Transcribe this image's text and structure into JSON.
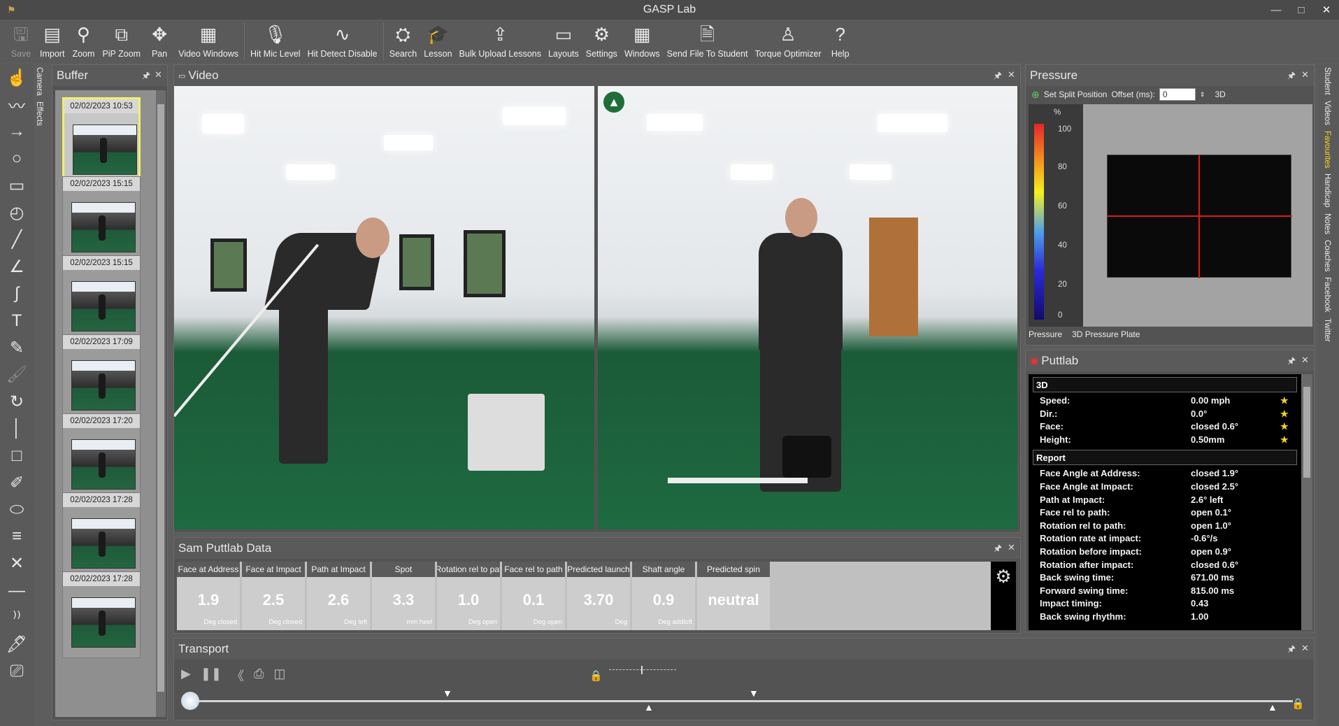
{
  "window": {
    "title": "GASP Lab",
    "minimize": "—",
    "maximize": "□",
    "close": "✕"
  },
  "toolbar": [
    {
      "label": "Save",
      "icon": "save-icon",
      "glyph": "🖫",
      "disabled": true
    },
    {
      "label": "Import",
      "icon": "import-icon",
      "glyph": "▤"
    },
    {
      "label": "Zoom",
      "icon": "zoom-icon",
      "glyph": "⚲"
    },
    {
      "label": "PiP Zoom",
      "icon": "pip-zoom-icon",
      "glyph": "⧉"
    },
    {
      "label": "Pan",
      "icon": "pan-icon",
      "glyph": "✥"
    },
    {
      "label": "Video Windows",
      "icon": "video-windows-icon",
      "glyph": "▦"
    },
    {
      "label": "Hit Mic Level",
      "icon": "microphone-icon",
      "glyph": "🎙"
    },
    {
      "label": "Hit Detect Disable",
      "icon": "hit-detect-icon",
      "glyph": "∿"
    },
    {
      "label": "Search",
      "icon": "search-icon",
      "glyph": "⛭"
    },
    {
      "label": "Lesson",
      "icon": "lesson-icon",
      "glyph": "🎓"
    },
    {
      "label": "Bulk Upload Lessons",
      "icon": "bulk-upload-icon",
      "glyph": "⇪"
    },
    {
      "label": "Layouts",
      "icon": "layouts-icon",
      "glyph": "▭"
    },
    {
      "label": "Settings",
      "icon": "settings-icon",
      "glyph": "⚙"
    },
    {
      "label": "Windows",
      "icon": "windows-icon",
      "glyph": "▦"
    },
    {
      "label": "Send File To Student",
      "icon": "send-file-icon",
      "glyph": "🗎"
    },
    {
      "label": "Torque Optimizer",
      "icon": "torque-optimizer-icon",
      "glyph": "♙"
    },
    {
      "label": "Help",
      "icon": "help-icon",
      "glyph": "?"
    }
  ],
  "left_tools": [
    {
      "name": "hand-tool-icon",
      "glyph": "☝",
      "disabled": true
    },
    {
      "name": "freehand-tool-icon",
      "glyph": "〰"
    },
    {
      "name": "arrow-tool-icon",
      "glyph": "→"
    },
    {
      "name": "circle-tool-icon",
      "glyph": "○"
    },
    {
      "name": "rectangle-tool-icon",
      "glyph": "▭"
    },
    {
      "name": "clock-tool-icon",
      "glyph": "◴"
    },
    {
      "name": "line-tool-icon",
      "glyph": "╱"
    },
    {
      "name": "angle-tool-icon",
      "glyph": "∠"
    },
    {
      "name": "curve-tool-icon",
      "glyph": "∫"
    },
    {
      "name": "text-tool-icon",
      "glyph": "T"
    },
    {
      "name": "eraser-tool-icon",
      "glyph": "✎"
    },
    {
      "name": "paint-tool-icon",
      "glyph": "🖌",
      "disabled": true
    },
    {
      "name": "rotate-tool-icon",
      "glyph": "↻"
    },
    {
      "name": "vertical-line-tool-icon",
      "glyph": "│"
    },
    {
      "name": "square-tool-icon",
      "glyph": "□"
    },
    {
      "name": "eyedropper-tool-icon",
      "glyph": "✐"
    },
    {
      "name": "ellipse-tool-icon",
      "glyph": "⬭"
    },
    {
      "name": "grid-lines-tool-icon",
      "glyph": "≡"
    },
    {
      "name": "cross-tool-icon",
      "glyph": "✕"
    },
    {
      "name": "horizontal-line-tool-icon",
      "glyph": "—"
    },
    {
      "name": "parallel-curves-tool-icon",
      "glyph": "⁾⁾"
    },
    {
      "name": "brush-tool-icon",
      "glyph": "🖋"
    },
    {
      "name": "clear-tool-icon",
      "glyph": "⎚"
    }
  ],
  "side_tabs": [
    "Camera",
    "Effects"
  ],
  "buffer": {
    "title": "Buffer",
    "items": [
      {
        "timestamp": "02/02/2023 10:53",
        "selected": true
      },
      {
        "timestamp": "02/02/2023 15:15"
      },
      {
        "timestamp": "02/02/2023 15:15"
      },
      {
        "timestamp": "02/02/2023 17:09"
      },
      {
        "timestamp": "02/02/2023 17:20"
      },
      {
        "timestamp": "02/02/2023 17:28"
      },
      {
        "timestamp": "02/02/2023 17:28"
      }
    ]
  },
  "video": {
    "title": "Video"
  },
  "pressure": {
    "title": "Pressure",
    "set_split": "Set Split Position",
    "offset_label": "Offset (ms):",
    "offset_value": "0",
    "mode_3d": "3D",
    "unit": "%",
    "scale": [
      "100",
      "80",
      "60",
      "40",
      "20",
      "0"
    ],
    "tabs": [
      "Pressure",
      "3D Pressure Plate"
    ]
  },
  "puttlab": {
    "title": "Puttlab",
    "section_3d": "3D",
    "rows_3d": [
      {
        "key": "Speed:",
        "value": "0.00 mph"
      },
      {
        "key": "Dir.:",
        "value": "0.0°"
      },
      {
        "key": "Face:",
        "value": "closed 0.6°"
      },
      {
        "key": "Height:",
        "value": "0.50mm"
      }
    ],
    "star": "★",
    "section_report": "Report",
    "rows_report": [
      {
        "key": "Face Angle at Address:",
        "value": "closed 1.9°"
      },
      {
        "key": "Face Angle at Impact:",
        "value": "closed 2.5°"
      },
      {
        "key": "Path at Impact:",
        "value": "2.6° left"
      },
      {
        "key": "Face rel to path:",
        "value": "open 0.1°"
      },
      {
        "key": "Rotation rel to path:",
        "value": "open 1.0°"
      },
      {
        "key": "Rotation rate at impact:",
        "value": "-0.6°/s"
      },
      {
        "key": "Rotation before impact:",
        "value": "open 0.9°"
      },
      {
        "key": "Rotation after impact:",
        "value": "closed 0.6°"
      },
      {
        "key": "Back swing time:",
        "value": "671.00 ms"
      },
      {
        "key": "Forward swing time:",
        "value": "815.00 ms"
      },
      {
        "key": "Impact timing:",
        "value": "0.43"
      },
      {
        "key": "Back swing rhythm:",
        "value": "1.00"
      }
    ]
  },
  "sam": {
    "title": "Sam Puttlab Data",
    "metrics": [
      {
        "header": "Face at Address",
        "value": "1.9",
        "unit": "Deg closed"
      },
      {
        "header": "Face at Impact",
        "value": "2.5",
        "unit": "Deg closed"
      },
      {
        "header": "Path at Impact",
        "value": "2.6",
        "unit": "Deg left"
      },
      {
        "header": "Spot",
        "value": "3.3",
        "unit": "mm heel"
      },
      {
        "header": "Rotation rel to pat",
        "value": "1.0",
        "unit": "Deg open"
      },
      {
        "header": "Face rel to path",
        "value": "0.1",
        "unit": "Deg open"
      },
      {
        "header": "Predicted launch",
        "value": "3.70",
        "unit": "Deg"
      },
      {
        "header": "Shaft angle",
        "value": "0.9",
        "unit": "Deg addloft"
      },
      {
        "header": "Predicted spin",
        "value": "neutral",
        "unit": ""
      }
    ]
  },
  "transport": {
    "title": "Transport"
  },
  "right_tabs": [
    "Student",
    "Videos",
    "Favourites",
    "Handicap",
    "Notes",
    "Coaches",
    "Facebook",
    "Twitter"
  ],
  "panel_controls": {
    "pin": "🖈",
    "close": "✕"
  }
}
